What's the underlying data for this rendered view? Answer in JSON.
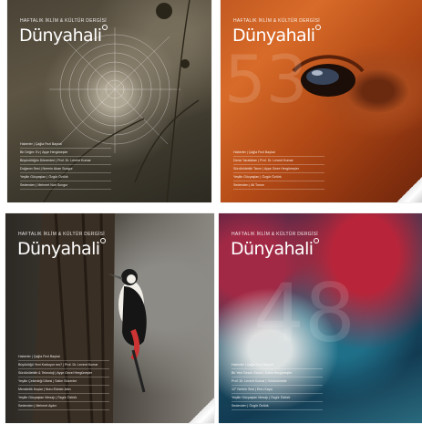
{
  "covers": [
    {
      "kicker": "HAFTALIK İKLİM & KÜLTÜR DERGİSİ",
      "logo": "Dünyahali",
      "toc": [
        "Haberler | Çağla Fezi Baykal",
        "Bir Değer: Ev | Ayşe Hergüneşler",
        "Büyücülüğün Dönemleri | Prof. Dr. Levent Kumar",
        "Doğanın Sesi | Nermin Akan Sungur",
        "Yeşilin Gözyaşları | Özgür Öztürk",
        "Sedenden | Mehmet Nuri Sungur"
      ]
    },
    {
      "kicker": "HAFTALIK İKLİM & KÜLTÜR DERGİSİ",
      "logo": "Dünyahali",
      "toc": [
        "Haberler | Çağla Fezi Baykal",
        "Deniz Yaratıkları | Prof. Dr. Levent Kumar",
        "Sürdürülebilir Tarım | Ayşe Geze Hergüneşler",
        "Yeşilin Gözyaşları | Özgür Öztürk",
        "Sedenden | Ali Tonun"
      ]
    },
    {
      "kicker": "HAFTALIK İKLİM & KÜLTÜR DERGİSİ",
      "logo": "Dünyahali",
      "toc": [
        "Haberler | Çağla Fezi Baykal",
        "Büyüklüğü Yeni Korkuyor mu? | Prof. Dr. Levent Kumar",
        "Sürdürülebilir & Teknoloji | Ayşe Gezel Hergüneşler",
        "Yeşilin Çekirdeği Ülkesi | Salim Sözenler",
        "Mevsimlik Kuşlar | Nuru Ekinler Altın",
        "Yeşilin Gözyaşları Mesajı | Özgür Öztürk",
        "Sedenden | Mehmet Aydın"
      ]
    },
    {
      "kicker": "HAFTALIK İKLİM & KÜLTÜR DERGİSİ",
      "logo": "Dünyahali",
      "toc": [
        "Haberler | Çağla Fezi Baykal",
        "Bir Yeni Sezon Sanat | Salim Hergüneşler",
        "Prof. Dr. Levent Kumar | Sürdürülebilir",
        "12° Nehrin Sesi | Ebru Kaya",
        "Yeşilin Gözyaşları Mesajı | Özgür Öztürk",
        "Sedenden | Özgür Öztürk"
      ]
    }
  ],
  "icons": {
    "logo_mark": "ring-icon",
    "page_curl": "page-curl-icon"
  }
}
